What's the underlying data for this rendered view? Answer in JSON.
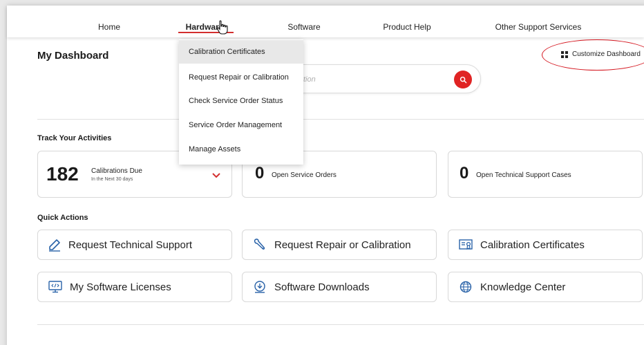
{
  "nav": {
    "items": [
      {
        "label": "Home"
      },
      {
        "label": "Hardware"
      },
      {
        "label": "Software"
      },
      {
        "label": "Product Help"
      },
      {
        "label": "Other Support Services"
      }
    ],
    "active": "Hardware"
  },
  "dropdown": {
    "items": [
      {
        "label": "Calibration Certificates",
        "highlighted": true
      },
      {
        "label": "Request Repair or Calibration"
      },
      {
        "label": "Check Service Order Status"
      },
      {
        "label": "Service Order Management"
      },
      {
        "label": "Manage Assets"
      }
    ]
  },
  "header": {
    "title": "My Dashboard",
    "customize_label": "Customize Dashboard"
  },
  "search": {
    "placeholder_visible": "tion"
  },
  "activities": {
    "title": "Track Your Activities",
    "cards": [
      {
        "count": "182",
        "label": "Calibrations Due",
        "sublabel": "In the Next 30 days"
      },
      {
        "count": "0",
        "label": "Open Service Orders"
      },
      {
        "count": "0",
        "label": "Open Technical Support Cases"
      }
    ]
  },
  "quick_actions": {
    "title": "Quick Actions",
    "items": [
      {
        "label": "Request Technical Support",
        "icon": "edit-icon"
      },
      {
        "label": "Request Repair or Calibration",
        "icon": "wrench-icon"
      },
      {
        "label": "Calibration Certificates",
        "icon": "certificate-icon"
      },
      {
        "label": "My Software Licenses",
        "icon": "code-monitor-icon"
      },
      {
        "label": "Software Downloads",
        "icon": "download-icon"
      },
      {
        "label": "Knowledge Center",
        "icon": "globe-icon"
      }
    ]
  },
  "colors": {
    "accent": "#d32f2f",
    "search_button": "#e02424",
    "icon_blue": "#2962a8",
    "highlight_ellipse": "#d4131c"
  }
}
